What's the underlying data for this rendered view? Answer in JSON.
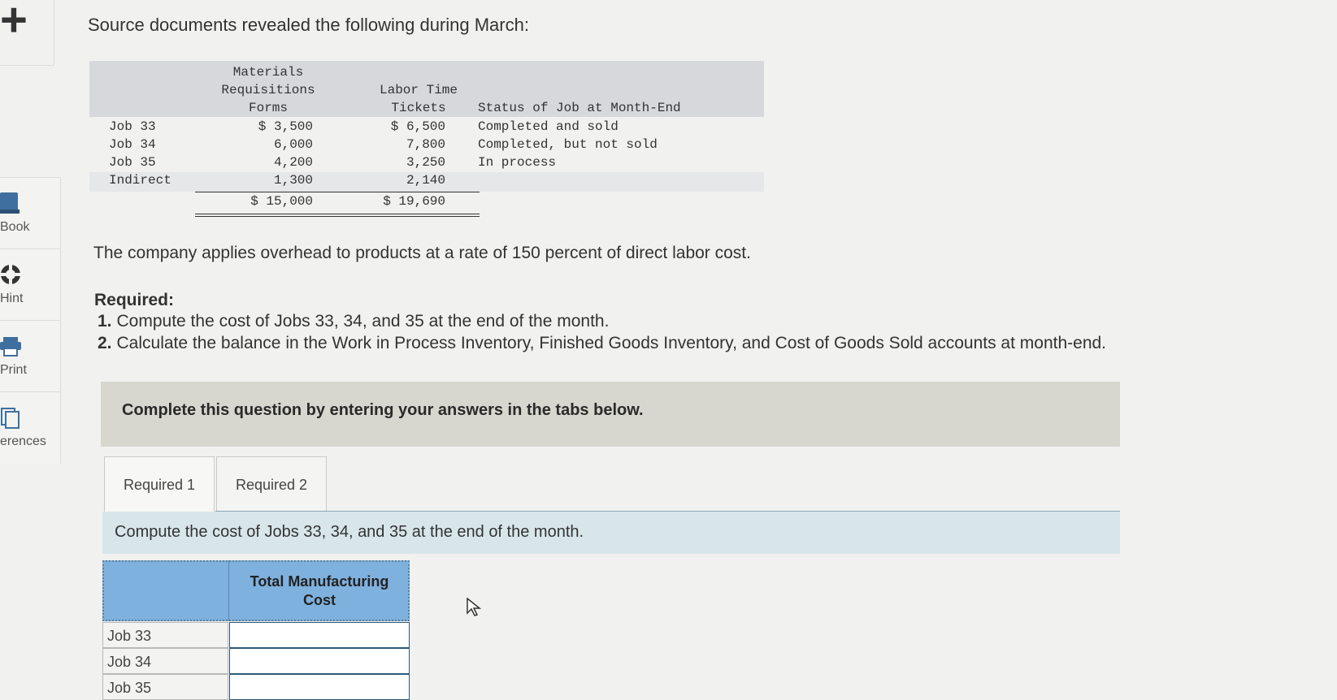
{
  "sidebar": {
    "items": [
      {
        "label": "Book",
        "icon": "book-icon"
      },
      {
        "label": "Hint",
        "icon": "lifebuoy-icon"
      },
      {
        "label": "Print",
        "icon": "printer-icon"
      },
      {
        "label": "erences",
        "icon": "references-icon"
      }
    ]
  },
  "heading": "Source documents revealed the following during March:",
  "table": {
    "headers": {
      "materials": [
        "Materials",
        "Requisitions",
        "Forms"
      ],
      "labor": [
        "Labor Time",
        "Tickets"
      ],
      "status": "Status of Job at Month-End"
    },
    "rows": [
      {
        "job": "Job 33",
        "materials": "$ 3,500",
        "labor": "$ 6,500",
        "status": "Completed and sold"
      },
      {
        "job": "Job 34",
        "materials": "6,000",
        "labor": "7,800",
        "status": "Completed, but not sold"
      },
      {
        "job": "Job 35",
        "materials": "4,200",
        "labor": "3,250",
        "status": "In process"
      },
      {
        "job": "Indirect",
        "materials": "1,300",
        "labor": "2,140",
        "status": ""
      }
    ],
    "totals": {
      "materials": "$ 15,000",
      "labor": "$ 19,690"
    }
  },
  "rate_text": "The company applies overhead to products at a rate of 150 percent of direct labor cost.",
  "required": {
    "title": "Required:",
    "items": [
      {
        "num": "1.",
        "text": "Compute the cost of Jobs 33, 34, and 35 at the end of the month."
      },
      {
        "num": "2.",
        "text": "Calculate the balance in the Work in Process Inventory, Finished Goods Inventory, and Cost of Goods Sold accounts at month-end."
      }
    ]
  },
  "banner": "Complete this question by entering your answers in the tabs below.",
  "tabs": [
    "Required 1",
    "Required 2"
  ],
  "instruction": "Compute the cost of Jobs 33, 34, and 35 at the end of the month.",
  "answer_table": {
    "header": [
      "Total Manufacturing",
      "Cost"
    ],
    "rows": [
      {
        "label": "Job 33",
        "value": ""
      },
      {
        "label": "Job 34",
        "value": ""
      },
      {
        "label": "Job 35",
        "value": ""
      }
    ]
  }
}
